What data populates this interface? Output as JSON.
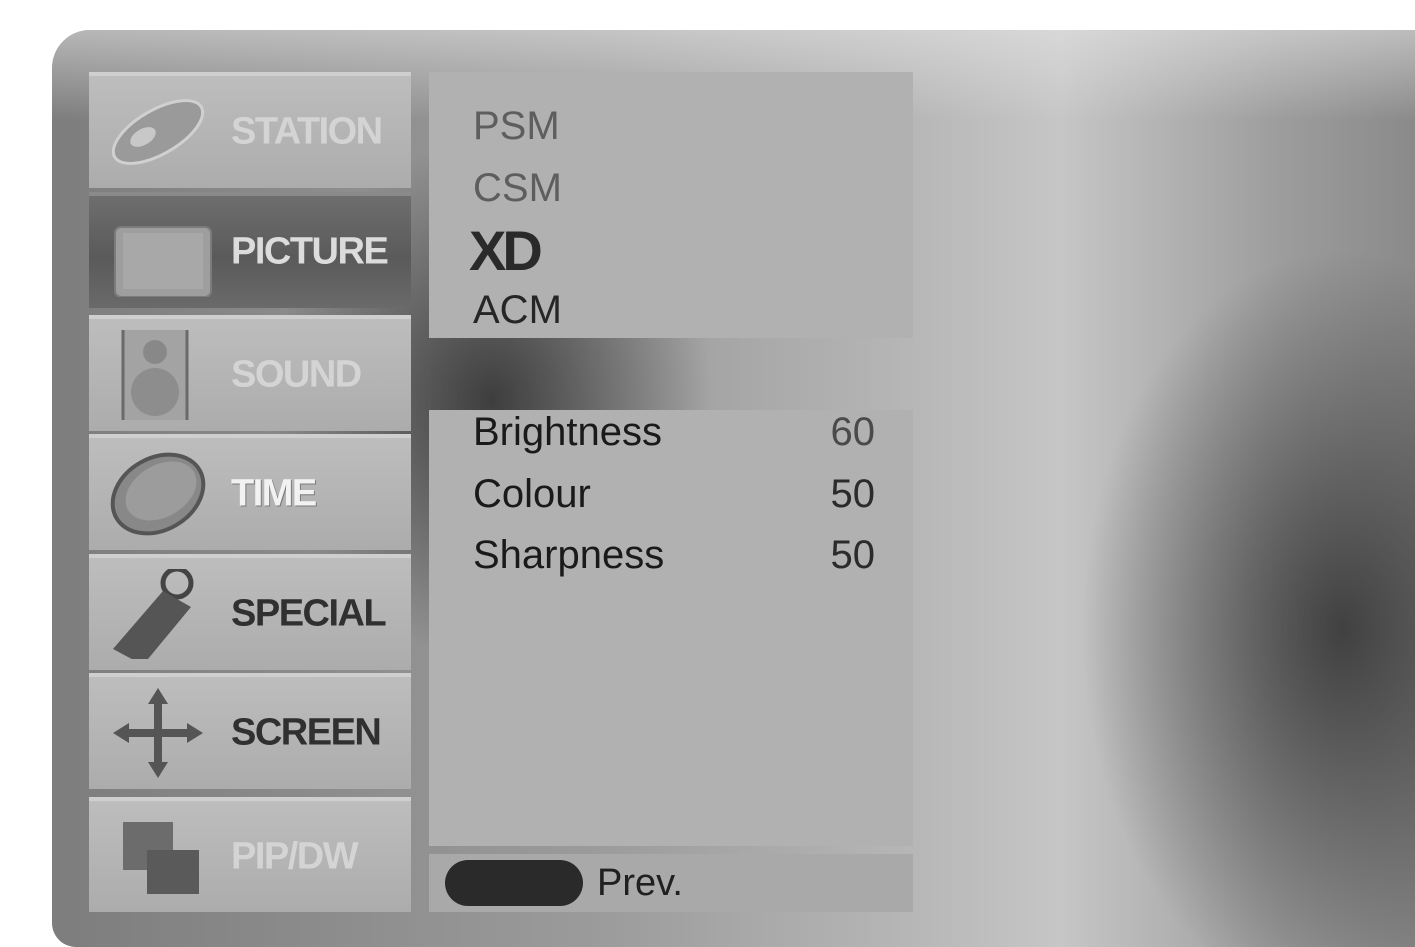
{
  "menu": {
    "items": [
      {
        "label": "STATION",
        "icon": "satellite-dish-icon"
      },
      {
        "label": "PICTURE",
        "icon": "tv-screen-icon",
        "active": true
      },
      {
        "label": "SOUND",
        "icon": "speaker-icon"
      },
      {
        "label": "TIME",
        "icon": "clock-icon"
      },
      {
        "label": "SPECIAL",
        "icon": "key-tag-icon"
      },
      {
        "label": "SCREEN",
        "icon": "move-arrows-icon"
      },
      {
        "label": "PIP/DW",
        "icon": "pip-windows-icon"
      }
    ]
  },
  "picture_menu": {
    "psm": "PSM",
    "csm": "CSM",
    "xd": "XD",
    "acm": "ACM"
  },
  "adjustments": [
    {
      "label": "Brightness",
      "value": "60"
    },
    {
      "label": "Colour",
      "value": "50"
    },
    {
      "label": "Sharpness",
      "value": "50"
    }
  ],
  "footer": {
    "prev_label": "Prev."
  },
  "colors": {
    "panel": "#b1b1b1",
    "active_menu": "#5a5a5a",
    "text": "#262626"
  }
}
